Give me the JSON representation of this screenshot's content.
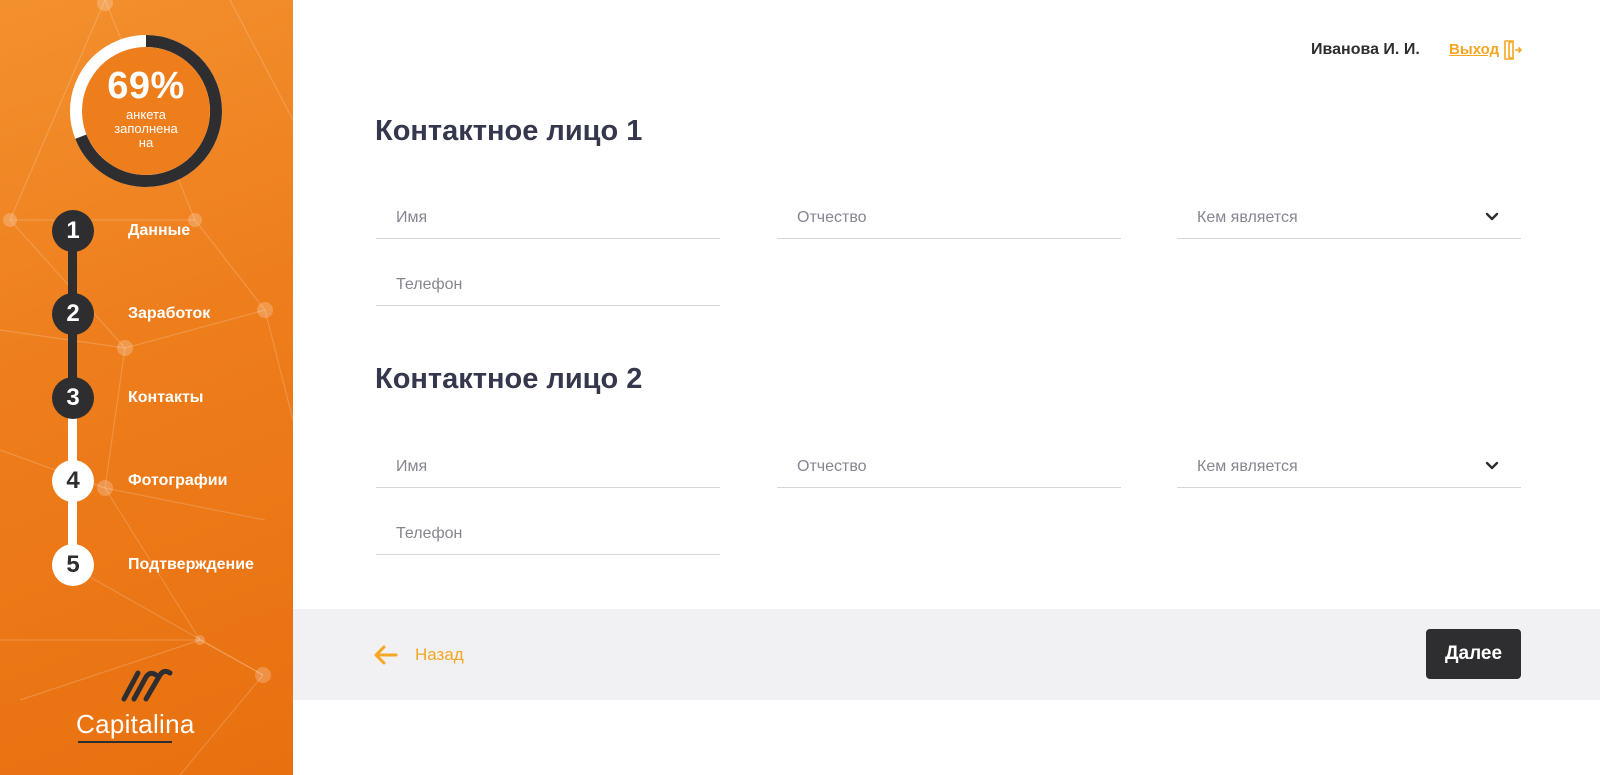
{
  "sidebar": {
    "progress": {
      "value_text": "69%",
      "value": 0.69,
      "caption": "анкета заполнена на"
    },
    "steps": [
      {
        "number": "1",
        "label": "Данные",
        "status": "done"
      },
      {
        "number": "2",
        "label": "Заработок",
        "status": "done"
      },
      {
        "number": "3",
        "label": "Контакты",
        "status": "current"
      },
      {
        "number": "4",
        "label": "Фотографии",
        "status": "todo"
      },
      {
        "number": "5",
        "label": "Подтверждение",
        "status": "todo"
      }
    ],
    "logo": {
      "text_regular": "Capital",
      "text_accent": "ina"
    }
  },
  "header": {
    "user_name": "Иванова И. И.",
    "logout_label": "Выход"
  },
  "sections": [
    {
      "title": "Контактное лицо 1",
      "fields": {
        "name_placeholder": "Имя",
        "patronymic_placeholder": "Отчество",
        "relation_placeholder": "Кем является",
        "phone_placeholder": "Телефон"
      }
    },
    {
      "title": "Контактное лицо 2",
      "fields": {
        "name_placeholder": "Имя",
        "patronymic_placeholder": "Отчество",
        "relation_placeholder": "Кем является",
        "phone_placeholder": "Телефон"
      }
    }
  ],
  "footer": {
    "back_label": "Назад",
    "next_label": "Далее"
  },
  "colors": {
    "accent": "#f5a623",
    "sidebar_orange": "#ee7d1c",
    "dark": "#2e2e30",
    "title": "#35384d"
  }
}
